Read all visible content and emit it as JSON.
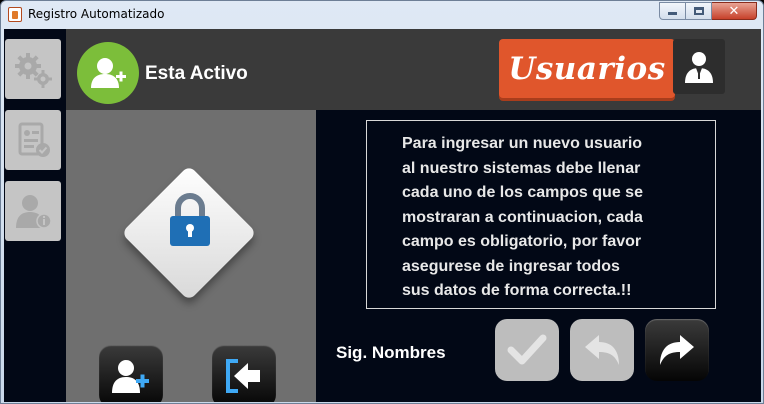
{
  "window": {
    "title": "Registro Automatizado",
    "controls": {
      "minimize": "minimize-icon",
      "maximize": "maximize-icon",
      "close": "✕"
    }
  },
  "sidebar": {
    "items": [
      {
        "icon": "gears-icon",
        "label": ""
      },
      {
        "icon": "report-check-icon",
        "label": ""
      },
      {
        "icon": "user-info-icon",
        "label": ""
      }
    ]
  },
  "header": {
    "status_text": "Esta Activo",
    "status_icon": "user-add-icon",
    "section_label": "Usuarios",
    "section_icon": "businessman-icon"
  },
  "info": {
    "lines": [
      "Para ingresar un nuevo usuario",
      "al nuestro sistemas debe llenar",
      "cada uno de los campos que se",
      "mostraran a continuacion, cada",
      "campo es obligatorio, por favor",
      "asegurese de ingresar todos",
      "sus datos de forma correcta.!!"
    ]
  },
  "actions": {
    "add_user_icon": "user-add-icon",
    "exit_icon": "exit-icon"
  },
  "navigation": {
    "next_field_label": "Sig. Nombres",
    "confirm": {
      "icon": "check-icon",
      "enabled": false
    },
    "back": {
      "icon": "back-arrow-icon",
      "enabled": false
    },
    "forward": {
      "icon": "forward-arrow-icon",
      "enabled": true
    }
  },
  "colors": {
    "accent": "#e0562c",
    "status_green": "#7cbe3a",
    "lock_blue": "#1f6fb5",
    "header_bg": "#3a3a3a",
    "panel_bg": "#6f6f6f",
    "content_bg": "#020816"
  }
}
